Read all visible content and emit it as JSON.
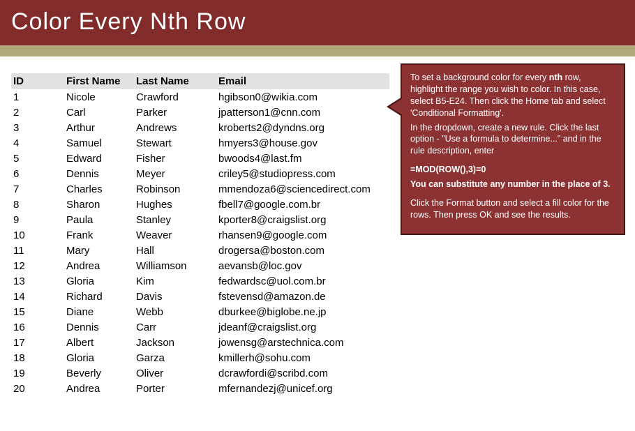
{
  "header": {
    "title": "Color Every Nth Row"
  },
  "table": {
    "headers": {
      "id": "ID",
      "first": "First Name",
      "last": "Last Name",
      "email": "Email"
    },
    "rows": [
      {
        "id": "1",
        "first": "Nicole",
        "last": "Crawford",
        "email": "hgibson0@wikia.com"
      },
      {
        "id": "2",
        "first": "Carl",
        "last": "Parker",
        "email": "jpatterson1@cnn.com"
      },
      {
        "id": "3",
        "first": "Arthur",
        "last": "Andrews",
        "email": "kroberts2@dyndns.org"
      },
      {
        "id": "4",
        "first": "Samuel",
        "last": "Stewart",
        "email": "hmyers3@house.gov"
      },
      {
        "id": "5",
        "first": "Edward",
        "last": "Fisher",
        "email": "bwoods4@last.fm"
      },
      {
        "id": "6",
        "first": "Dennis",
        "last": "Meyer",
        "email": "criley5@studiopress.com"
      },
      {
        "id": "7",
        "first": "Charles",
        "last": "Robinson",
        "email": "mmendoza6@sciencedirect.com"
      },
      {
        "id": "8",
        "first": "Sharon",
        "last": "Hughes",
        "email": "fbell7@google.com.br"
      },
      {
        "id": "9",
        "first": "Paula",
        "last": "Stanley",
        "email": "kporter8@craigslist.org"
      },
      {
        "id": "10",
        "first": "Frank",
        "last": "Weaver",
        "email": "rhansen9@google.com"
      },
      {
        "id": "11",
        "first": "Mary",
        "last": "Hall",
        "email": "drogersa@boston.com"
      },
      {
        "id": "12",
        "first": "Andrea",
        "last": "Williamson",
        "email": "aevansb@loc.gov"
      },
      {
        "id": "13",
        "first": "Gloria",
        "last": "Kim",
        "email": "fedwardsc@uol.com.br"
      },
      {
        "id": "14",
        "first": "Richard",
        "last": "Davis",
        "email": "fstevensd@amazon.de"
      },
      {
        "id": "15",
        "first": "Diane",
        "last": "Webb",
        "email": "dburkee@biglobe.ne.jp"
      },
      {
        "id": "16",
        "first": "Dennis",
        "last": "Carr",
        "email": "jdeanf@craigslist.org"
      },
      {
        "id": "17",
        "first": "Albert",
        "last": "Jackson",
        "email": "jowensg@arstechnica.com"
      },
      {
        "id": "18",
        "first": "Gloria",
        "last": "Garza",
        "email": "kmillerh@sohu.com"
      },
      {
        "id": "19",
        "first": "Beverly",
        "last": "Oliver",
        "email": "dcrawfordi@scribd.com"
      },
      {
        "id": "20",
        "first": "Andrea",
        "last": "Porter",
        "email": "mfernandezj@unicef.org"
      }
    ]
  },
  "callout": {
    "p1_a": "To set a background color for every ",
    "p1_bold": "nth",
    "p1_b": " row, highlight the range you wish to color. In this case, select B5-E24. Then click the Home tab and select 'Conditional Formatting'.",
    "p2": "In the dropdown, create a new rule. Click the last option - \"Use a formula to determine...\" and in the rule description, enter",
    "formula": "=MOD(ROW(),3)=0",
    "sub": "You can substitute any number in the place of 3.",
    "p3": "Click the Format button and select a fill color for the rows. Then press OK and see the results."
  }
}
